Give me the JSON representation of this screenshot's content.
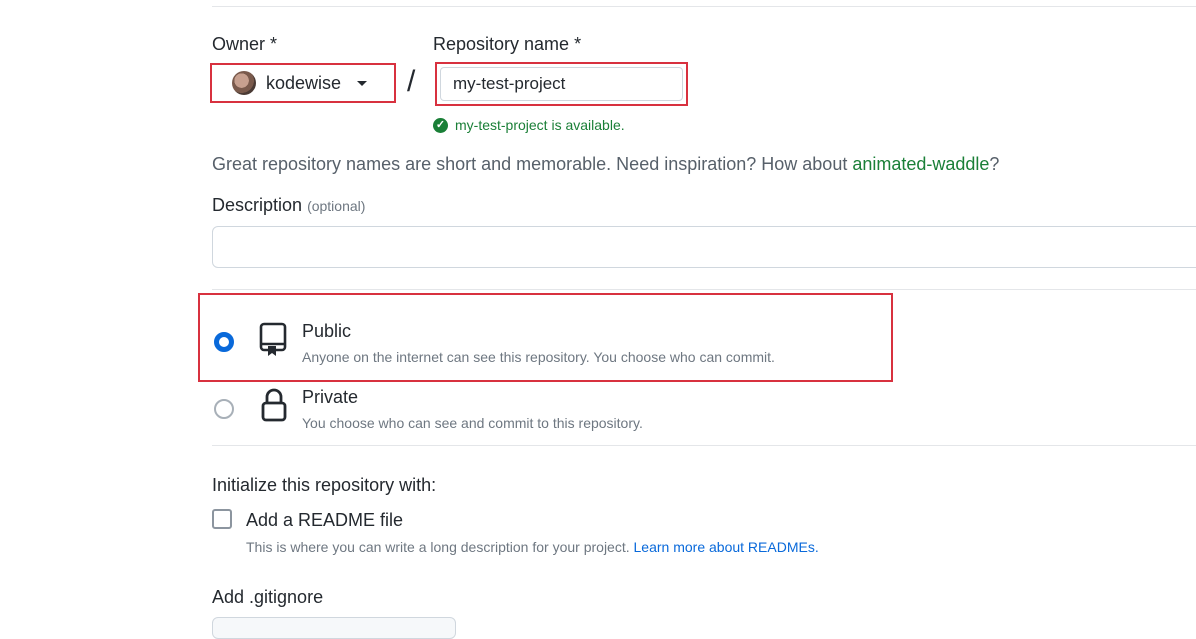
{
  "owner": {
    "label": "Owner *",
    "name": "kodewise"
  },
  "separator": "/",
  "repository": {
    "label": "Repository name *",
    "value": "my-test-project",
    "availability": "my-test-project is available."
  },
  "hint": {
    "text": "Great repository names are short and memorable. Need inspiration? How about ",
    "suggestion": "animated-waddle",
    "end": "?"
  },
  "description": {
    "label": "Description",
    "optional": "(optional)",
    "value": ""
  },
  "visibility": {
    "public": {
      "title": "Public",
      "subtitle": "Anyone on the internet can see this repository. You choose who can commit.",
      "selected": true
    },
    "private": {
      "title": "Private",
      "subtitle": "You choose who can see and commit to this repository.",
      "selected": false
    }
  },
  "initialize": {
    "heading": "Initialize this repository with:",
    "readme_label": "Add a README file",
    "readme_help": "This is where you can write a long description for your project. ",
    "readme_link": "Learn more about READMEs.",
    "readme_checked": false
  },
  "gitignore": {
    "label": "Add .gitignore"
  },
  "colors": {
    "highlight": "#d8313f",
    "success": "#1a7f37",
    "link": "#0969da",
    "radio_selected": "#0969da"
  },
  "icons": [
    "caret-down-icon",
    "check-circle-icon",
    "repo-icon",
    "lock-icon"
  ]
}
